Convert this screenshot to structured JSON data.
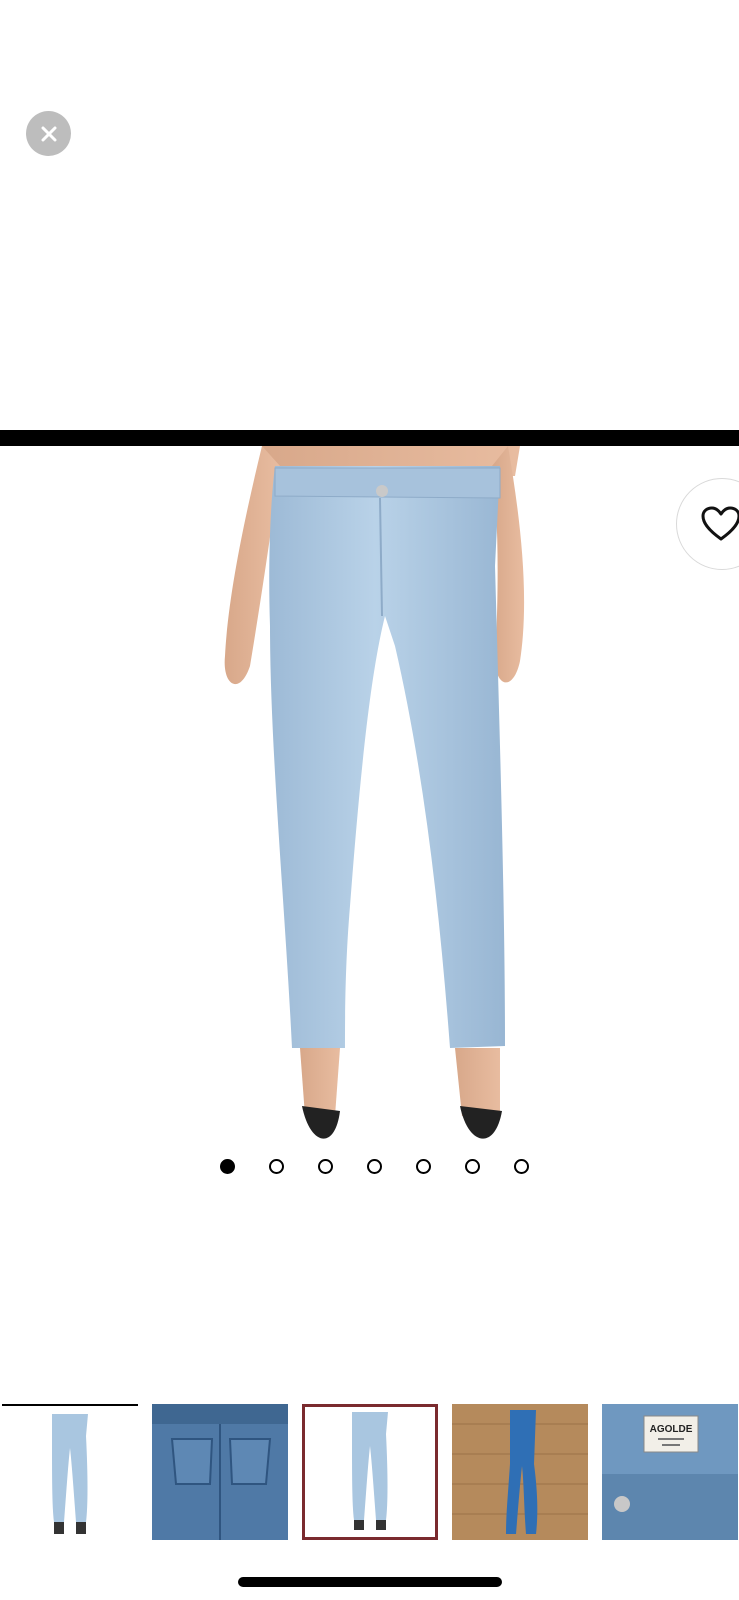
{
  "viewer": {
    "close_icon": "close-icon",
    "favorite_icon": "heart-icon",
    "photo_count": 7,
    "active_photo_index": 1
  },
  "pagination": [
    {
      "active": true
    },
    {
      "active": false
    },
    {
      "active": false
    },
    {
      "active": false
    },
    {
      "active": false
    },
    {
      "active": false
    },
    {
      "active": false
    }
  ],
  "thumbnails": [
    {
      "subject": "jeans-front-studio",
      "selected": false
    },
    {
      "subject": "jeans-back-pockets-closeup",
      "selected": false
    },
    {
      "subject": "jeans-front-studio",
      "selected": true
    },
    {
      "subject": "jeans-flat-on-wood-floor",
      "selected": false
    },
    {
      "subject": "waistband-label-closeup",
      "selected": false
    }
  ],
  "label_text": "AGOLDE",
  "colors": {
    "denim": "#a9c6e0",
    "selected_border": "#7a2a2e",
    "close_bg": "#bdbdbd"
  }
}
